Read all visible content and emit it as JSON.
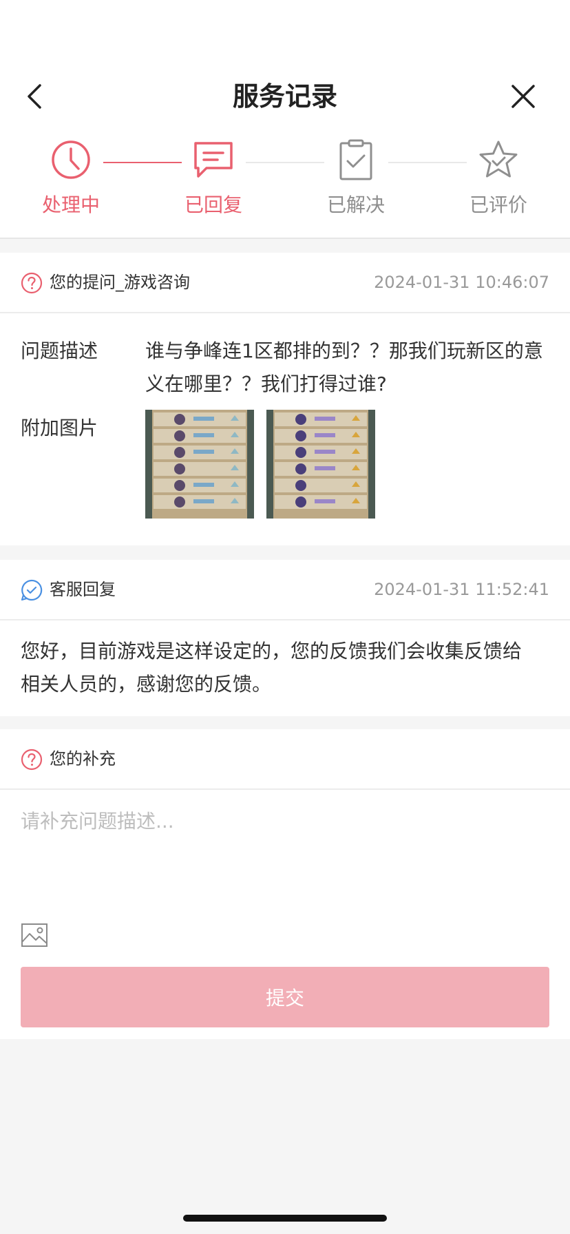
{
  "header": {
    "title": "服务记录"
  },
  "steps": [
    {
      "label": "处理中",
      "icon": "clock-icon",
      "state": "active"
    },
    {
      "label": "已回复",
      "icon": "message-icon",
      "state": "active"
    },
    {
      "label": "已解决",
      "icon": "clipboard-check-icon",
      "state": "inactive"
    },
    {
      "label": "已评价",
      "icon": "star-icon",
      "state": "inactive"
    }
  ],
  "question": {
    "header_title": "您的提问_游戏咨询",
    "timestamp": "2024-01-31 10:46:07",
    "desc_label": "问题描述",
    "desc_line1": "谁与争峰连1区都排的到？？那我们玩新区的意",
    "desc_line2": "义在哪里？？我们打得过谁?",
    "images_label": "附加图片"
  },
  "reply": {
    "header_title": "客服回复",
    "timestamp": "2024-01-31 11:52:41",
    "text_line1": "您好，目前游戏是这样设定的，您的反馈我们会收集反馈给",
    "text_line2": "相关人员的，感谢您的反馈。"
  },
  "supplement": {
    "header_title": "您的补充",
    "placeholder": "请补充问题描述...",
    "submit_label": "提交"
  },
  "colors": {
    "accent": "#e9606f",
    "inactive": "#8f8f8f",
    "submit_bg": "#f2aeb6",
    "reply_icon": "#4a90e2"
  }
}
